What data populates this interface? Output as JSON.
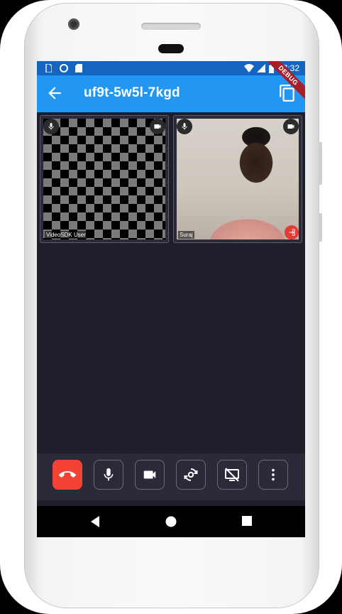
{
  "status_bar": {
    "time": "7:32",
    "left_icons": [
      "sim-icon",
      "sync-icon",
      "sd-card-icon"
    ],
    "right_icons": [
      "wifi-icon",
      "signal-icon",
      "battery-icon"
    ]
  },
  "debug_banner": "DEBUG",
  "app_bar": {
    "title": "uf9t-5w5l-7kgd",
    "back_icon": "arrow-back-icon",
    "copy_icon": "copy-icon"
  },
  "participants": [
    {
      "name": "VideoSDK User",
      "mic_icon": "mic-icon",
      "cam_icon": "videocam-icon",
      "video": "checkerboard-placeholder"
    },
    {
      "name": "Suraj",
      "mic_icon": "mic-icon",
      "cam_icon": "videocam-icon",
      "video": "camera-feed",
      "action_icon": "leave-icon"
    }
  ],
  "controls": [
    {
      "id": "end-call",
      "icon": "call-end-icon",
      "color": "#f44336"
    },
    {
      "id": "mic",
      "icon": "mic-icon"
    },
    {
      "id": "camera",
      "icon": "videocam-icon"
    },
    {
      "id": "switch-camera",
      "icon": "switch-camera-icon"
    },
    {
      "id": "screen-share",
      "icon": "screen-share-off-icon"
    },
    {
      "id": "more",
      "icon": "more-vert-icon"
    }
  ],
  "nav_bar": [
    "back-triangle-icon",
    "home-circle-icon",
    "recents-square-icon"
  ],
  "colors": {
    "app_bar": "#2196f3",
    "status_bar": "#1565c0",
    "background": "#1f1f2b",
    "end_call": "#f44336"
  }
}
